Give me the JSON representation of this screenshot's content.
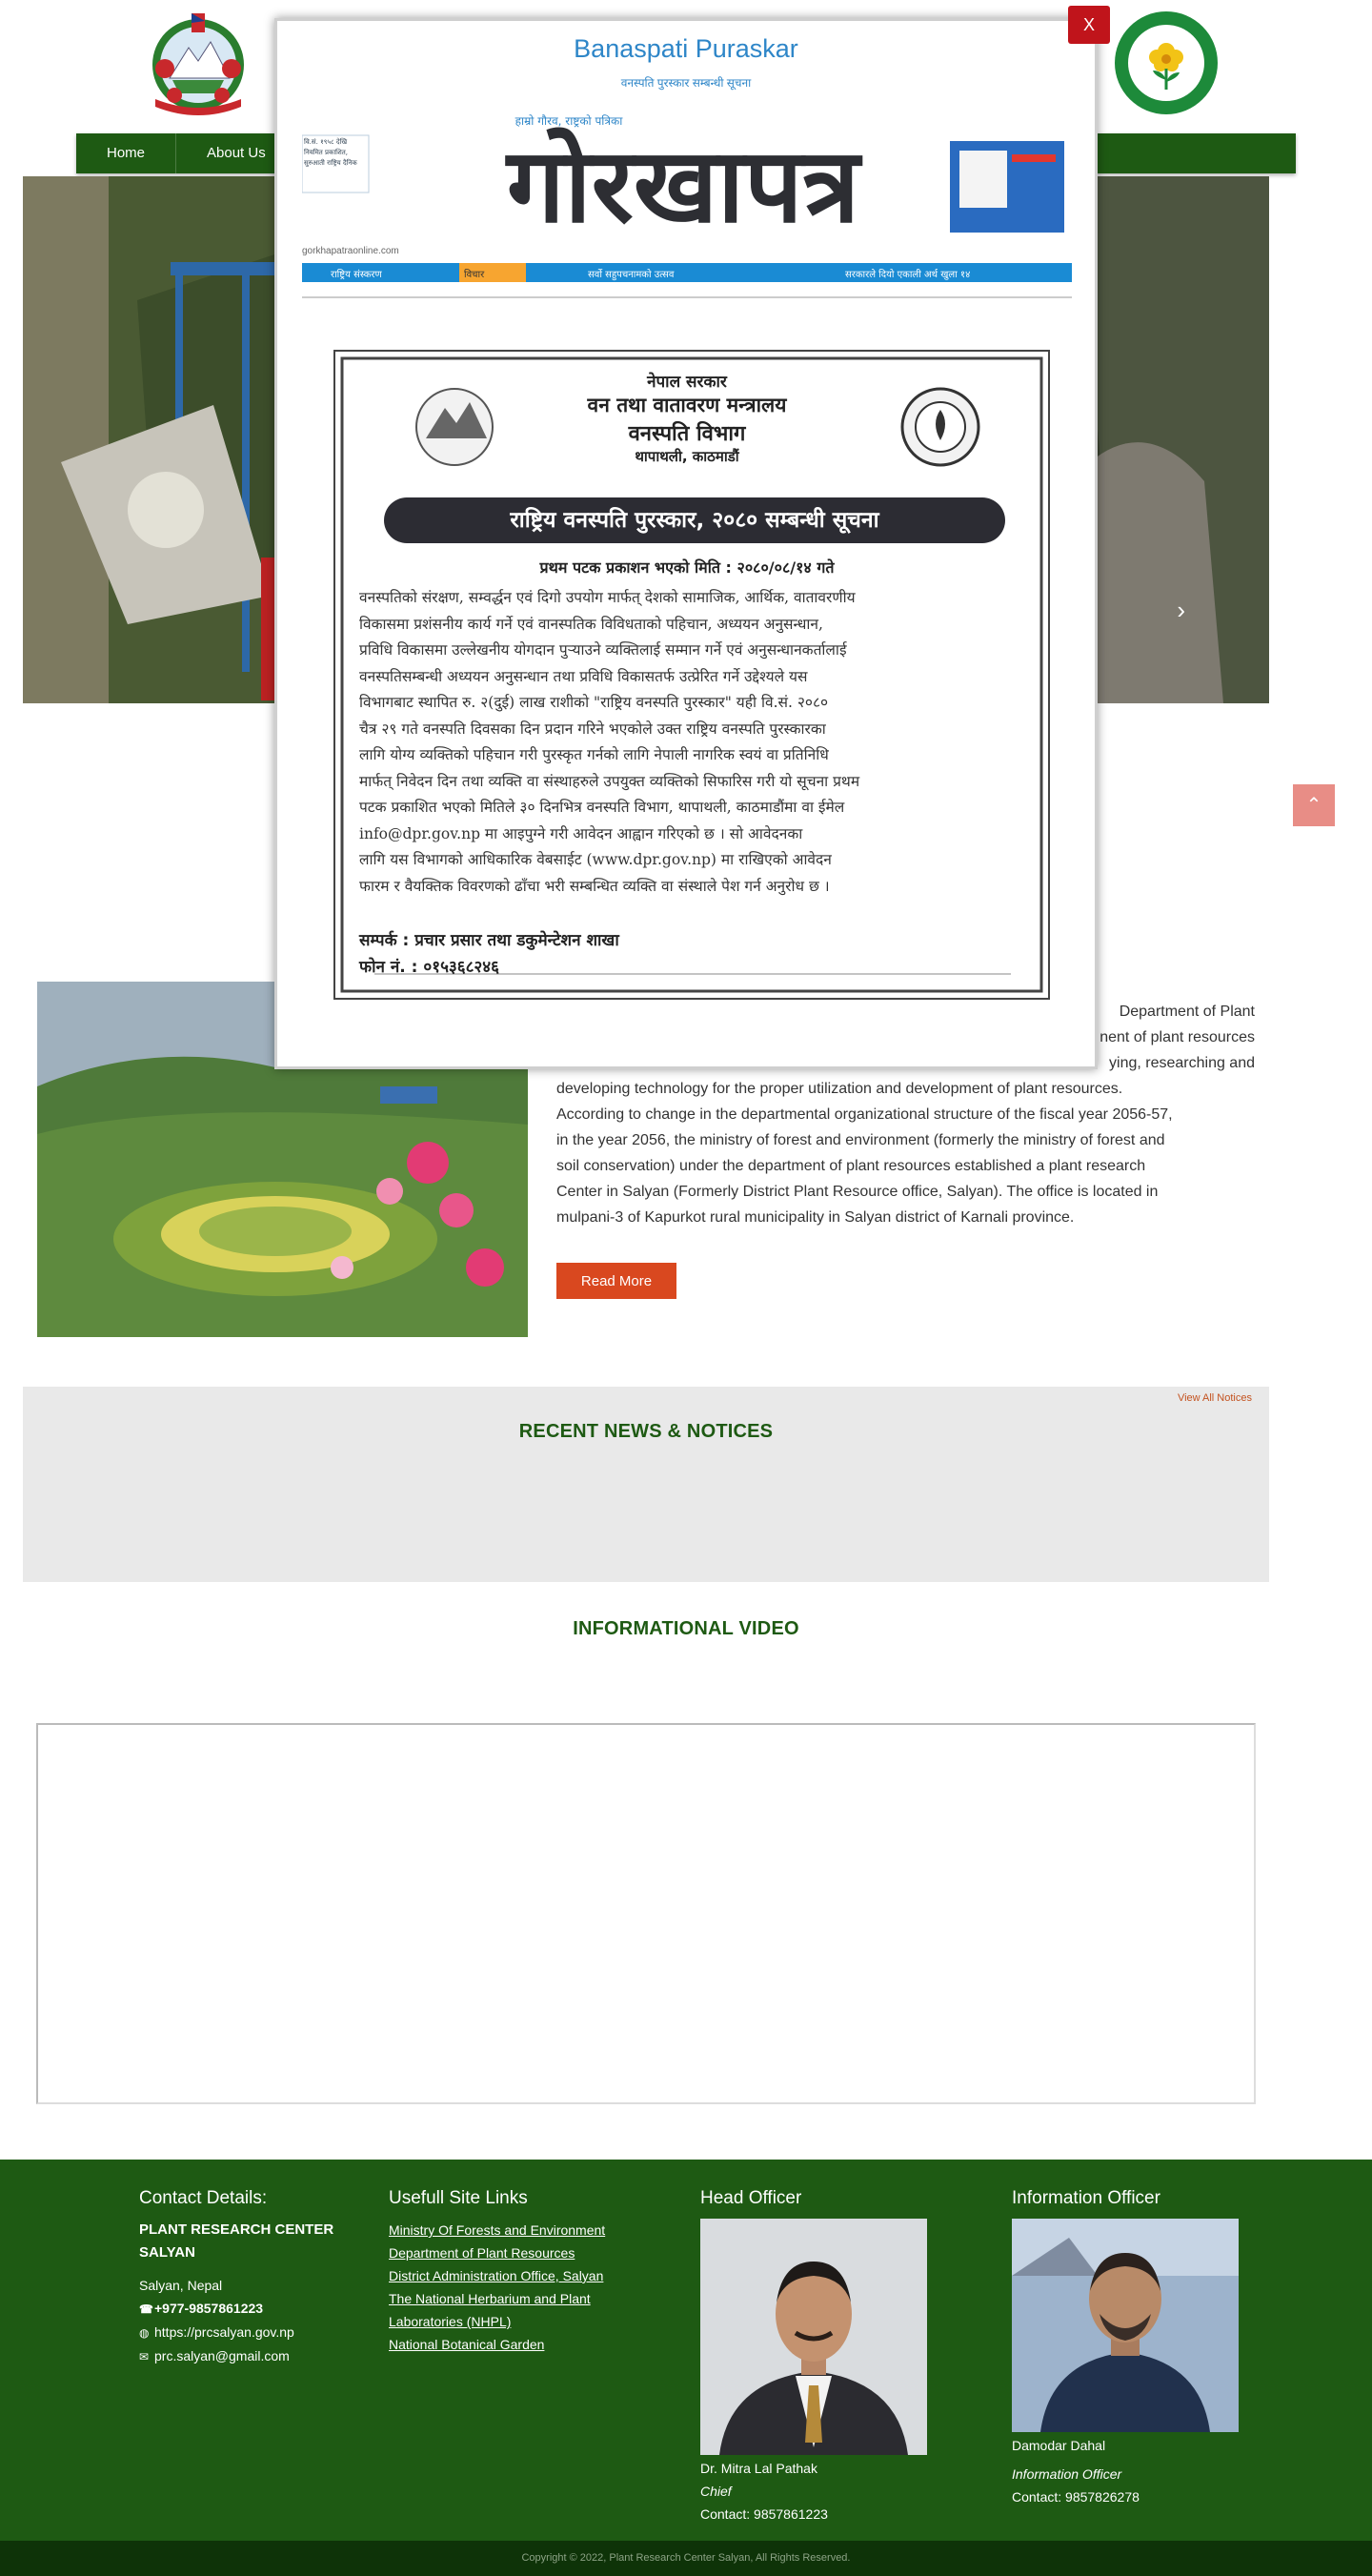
{
  "header": {
    "nav": [
      "Home",
      "About Us"
    ]
  },
  "about": {
    "text": "Department of Plant ... nent of plant resources ... ying, researching and developing technology for the proper utilization and development of plant resources. According to change in the departmental organizational structure of the fiscal year 2056-57, in the year 2056, the ministry of forest and environment (formerly the ministry of forest and soil conservation) under the department of plant resources established a plant research Center in Salyan (Formerly District Plant Resource office, Salyan). The office is located in mulpani-3 of Kapurkot rural municipality in Salyan district of Karnali province.",
    "visible_lines": [
      "Department of Plant",
      "nent of plant resources",
      "ying, researching and",
      "developing technology for the proper utilization and development of plant resources.",
      "According to change in the departmental organizational structure of the fiscal year 2056-57,",
      "in the year 2056, the ministry of forest and environment (formerly the ministry of forest and",
      "soil conservation) under the department of plant resources established a plant research",
      "Center in Salyan (Formerly District Plant Resource office, Salyan). The office is located in",
      "mulpani-3 of Kapurkot rural municipality in Salyan district of Karnali province."
    ],
    "read_more": "Read More"
  },
  "notices": {
    "view_all": "View All Notices",
    "title": "RECENT NEWS & NOTICES"
  },
  "video": {
    "title": "INFORMATIONAL VIDEO"
  },
  "footer": {
    "contact": {
      "heading": "Contact Details:",
      "org_line1": "PLANT RESEARCH CENTER",
      "org_line2": "SALYAN",
      "address": "Salyan, Nepal",
      "phone": "+977-9857861223",
      "website": "https://prcsalyan.gov.np",
      "email": "prc.salyan@gmail.com"
    },
    "links": {
      "heading": "Usefull Site Links",
      "items": [
        "Ministry Of Forests and Environment",
        "Department of Plant Resources",
        "District Administration Office, Salyan",
        "The National Herbarium and Plant",
        "Laboratories (NHPL)",
        "National Botanical Garden"
      ]
    },
    "head_officer": {
      "heading": "Head Officer",
      "name": "Dr. Mitra Lal Pathak",
      "role": "Chief",
      "contact": "Contact: 9857861223"
    },
    "info_officer": {
      "heading": "Information Officer",
      "name": "Damodar Dahal",
      "role": "Information Officer",
      "contact": "Contact: 9857826278"
    },
    "copyright": "Copyright © 2022, Plant Research Center Salyan, All Rights Reserved."
  },
  "modal": {
    "close": "X",
    "title": "Banaspati Puraskar",
    "subtitle": "वनस्पति पुरस्कार सम्बन्धी सूचना",
    "newspaper": {
      "tagline": "हाम्रो गौरव, राष्ट्रको पत्रिका",
      "masthead": "गोरखापत्र",
      "left_box": [
        "वि.सं. १९५८ देखि",
        "नियमित प्रकाशित,",
        "सुरुआती राष्ट्रिय दैनिक"
      ],
      "website": "gorkhapatraonline.com",
      "strip": [
        "राष्ट्रिय संस्करण",
        "विचार",
        "सर्वो सहुपचनामको उत्सव",
        "सरकारले दियो एकाली अर्थ खुला १४"
      ]
    },
    "notice": {
      "gov": "नेपाल सरकार",
      "ministry": "वन तथा वातावरण मन्त्रालय",
      "dept": "वनस्पति विभाग",
      "place": "थापाथली, काठमाडौं",
      "banner": "राष्ट्रिय वनस्पति पुरस्कार, २०८० सम्बन्धी सूचना",
      "date_line": "प्रथम पटक प्रकाशन भएको मिति : २०८०/०८/१४ गते",
      "body": [
        "वनस्पतिको संरक्षण, सम्वर्द्धन एवं दिगो उपयोग मार्फत् देशको सामाजिक, आर्थिक, वातावरणीय",
        "विकासमा प्रशंसनीय कार्य गर्ने एवं वानस्पतिक विविधताको पहिचान, अध्ययन अनुसन्धान,",
        "प्रविधि विकासमा उल्लेखनीय योगदान पुऱ्याउने व्यक्तिलाई सम्मान गर्ने एवं अनुसन्धानकर्तालाई",
        "वनस्पतिसम्बन्धी अध्ययन अनुसन्धान तथा प्रविधि विकासतर्फ उत्प्रेरित गर्ने उद्देश्यले यस",
        "विभागबाट स्थापित रु. २(दुई) लाख राशीको \"राष्ट्रिय वनस्पति पुरस्कार\" यही वि.सं. २०८०",
        "चैत्र २९ गते वनस्पति दिवसका दिन प्रदान गरिने भएकोले उक्त राष्ट्रिय वनस्पति पुरस्कारका",
        "लागि योग्य व्यक्तिको पहिचान गरी पुरस्कृत गर्नको लागि नेपाली नागरिक स्वयं वा प्रतिनिधि",
        "मार्फत् निवेदन दिन तथा व्यक्ति वा संस्थाहरुले उपयुक्त व्यक्तिको सिफारिस गरी यो सूचना प्रथम",
        "पटक प्रकाशित भएको मितिले ३० दिनभित्र वनस्पति विभाग, थापाथली, काठमाडौंमा वा ईमेल",
        "info@dpr.gov.np मा आइपुग्ने गरी आवेदन आह्वान गरिएको छ । सो आवेदनका",
        "लागि यस विभागको आधिकारिक वेबसाईट (www.dpr.gov.np) मा राखिएको आवेदन",
        "फारम र वैयक्तिक विवरणको ढाँचा भरी सम्बन्धित व्यक्ति वा संस्थाले पेश गर्न अनुरोध छ ।"
      ],
      "contact": "सम्पर्क : प्रचार प्रसार तथा डकुमेन्टेशन शाखा",
      "phone": "फोन नं. : ०१५३६८२४६"
    }
  }
}
